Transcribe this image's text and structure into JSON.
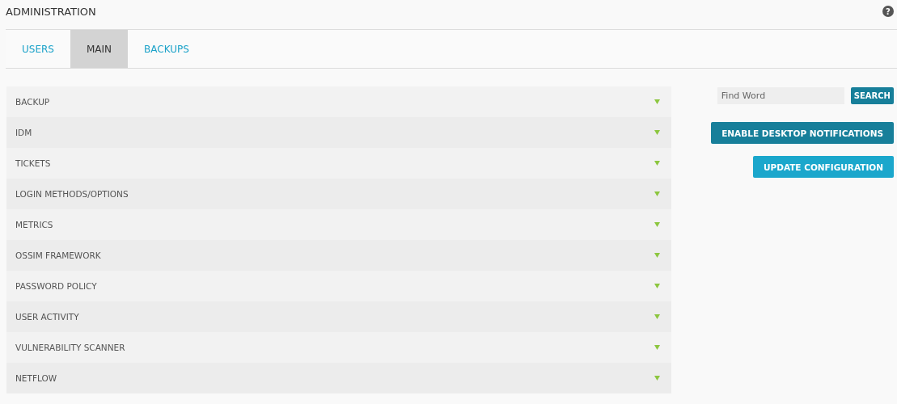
{
  "header": {
    "title": "ADMINISTRATION",
    "help": "?"
  },
  "tabs": [
    {
      "label": "USERS",
      "selected": false
    },
    {
      "label": "MAIN",
      "selected": true
    },
    {
      "label": "BACKUPS",
      "selected": false
    }
  ],
  "sections": [
    {
      "label": "BACKUP",
      "expanded": false
    },
    {
      "label": "IDM",
      "expanded": false
    },
    {
      "label": "TICKETS",
      "expanded": false
    },
    {
      "label": "LOGIN METHODS/OPTIONS",
      "expanded": false
    },
    {
      "label": "METRICS",
      "expanded": false
    },
    {
      "label": "OSSIM FRAMEWORK",
      "expanded": false
    },
    {
      "label": "PASSWORD POLICY",
      "expanded": false
    },
    {
      "label": "USER ACTIVITY",
      "expanded": false
    },
    {
      "label": "VULNERABILITY SCANNER",
      "expanded": false
    },
    {
      "label": "NETFLOW",
      "expanded": false
    }
  ],
  "search": {
    "placeholder": "Find Word",
    "button": "SEARCH"
  },
  "actions": [
    {
      "label": "ENABLE DESKTOP NOTIFICATIONS",
      "kind": "dark"
    },
    {
      "label": "UPDATE CONFIGURATION",
      "kind": "light"
    }
  ]
}
